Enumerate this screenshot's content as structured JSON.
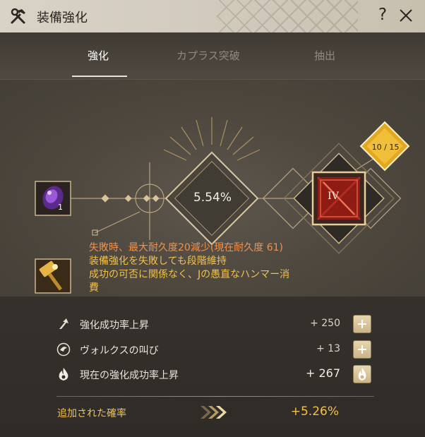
{
  "window": {
    "title": "装備強化"
  },
  "tabs": [
    {
      "label": "強化",
      "active": true
    },
    {
      "label": "カプラス突破",
      "active": false
    },
    {
      "label": "抽出",
      "active": false
    }
  ],
  "stage": {
    "success_chance": "5.54%",
    "material_count": "1",
    "enhancement_level": "IV",
    "stack_counter": "10 / 15"
  },
  "info_lines": [
    "失敗時、最大耐久度20減少(現在耐久度 61)",
    "装備強化を失敗しても段階維持",
    "成功の可否に関係なく、Jの愚直なハンマー消",
    "費"
  ],
  "rows": [
    {
      "icon": "arrow-up-icon",
      "label": "強化成功率上昇",
      "value": "+ 250"
    },
    {
      "icon": "volks-cry-icon",
      "label": "ヴォルクスの叫び",
      "value": "+ 13"
    },
    {
      "icon": "flame-icon",
      "label": "現在の強化成功率上昇",
      "value": "+ 267"
    }
  ],
  "summary": {
    "label": "追加された確率",
    "value": "+5.26%"
  },
  "colors": {
    "accent_gold": "#f2c14b",
    "warning_orange": "#f2914b",
    "title_bar": "#d9d3c6"
  }
}
